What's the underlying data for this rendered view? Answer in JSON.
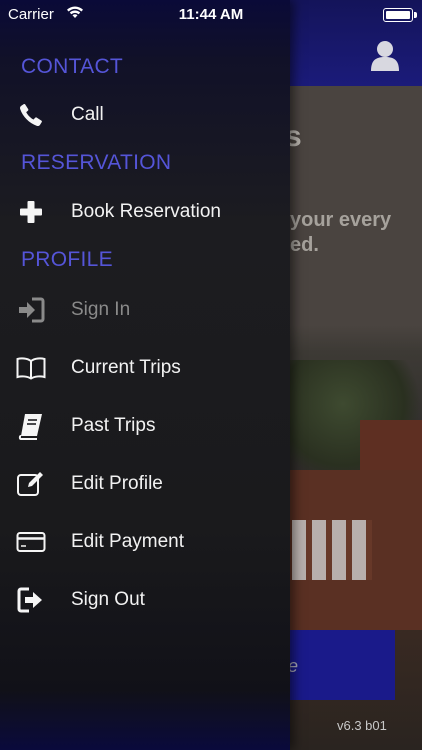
{
  "status_bar": {
    "carrier": "Carrier",
    "time": "11:44 AM"
  },
  "drawer": {
    "sections": [
      {
        "header": "CONTACT",
        "items": [
          {
            "label": "Call",
            "icon": "phone-icon",
            "enabled": true
          }
        ]
      },
      {
        "header": "RESERVATION",
        "items": [
          {
            "label": "Book Reservation",
            "icon": "plus-icon",
            "enabled": true
          }
        ]
      },
      {
        "header": "PROFILE",
        "items": [
          {
            "label": "Sign In",
            "icon": "sign-in-icon",
            "enabled": false
          },
          {
            "label": "Current Trips",
            "icon": "open-book-icon",
            "enabled": true
          },
          {
            "label": "Past Trips",
            "icon": "closed-book-icon",
            "enabled": true
          },
          {
            "label": "Edit Profile",
            "icon": "edit-icon",
            "enabled": true
          },
          {
            "label": "Edit Payment",
            "icon": "credit-card-icon",
            "enabled": true
          },
          {
            "label": "Sign Out",
            "icon": "sign-out-icon",
            "enabled": true
          }
        ]
      }
    ]
  },
  "background_screen": {
    "title_fragment": "ress",
    "subtitle_line1": "your every",
    "subtitle_line2": "ed.",
    "button_fragment": "e",
    "version": "v6.3  b01"
  },
  "colors": {
    "section_header": "#5555d8",
    "navbar": "#1b1b7a",
    "menu_text": "#f2f2f2",
    "disabled_text": "#8a8a8a"
  }
}
